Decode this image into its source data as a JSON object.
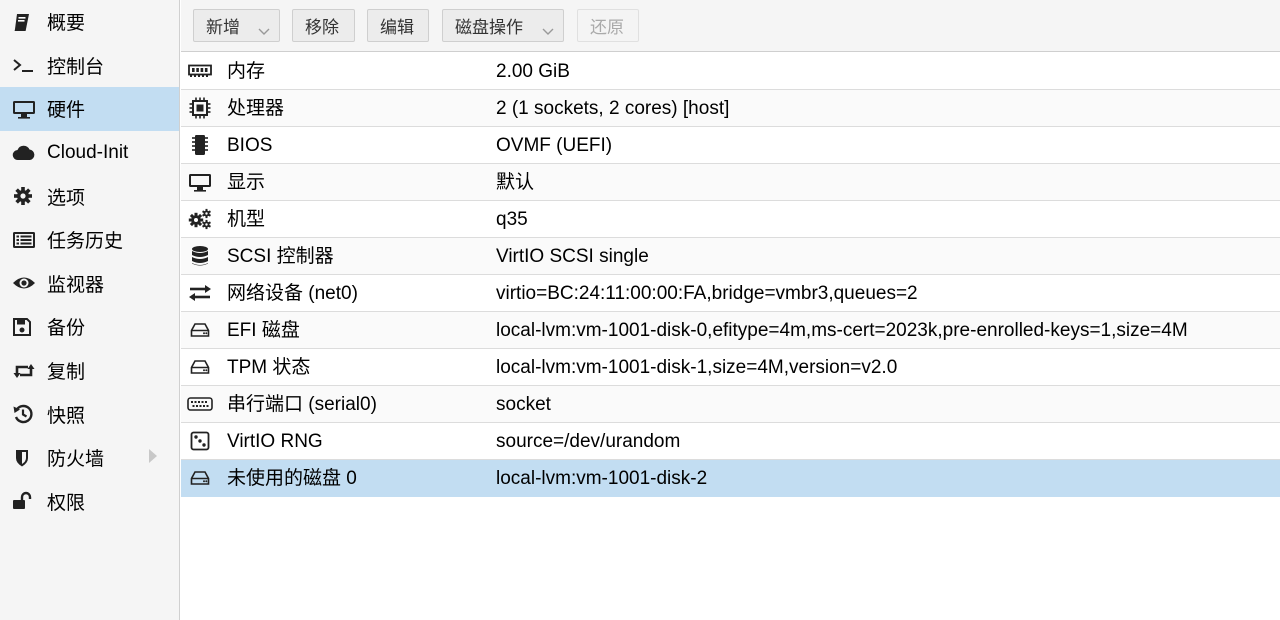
{
  "sidebar": {
    "items": [
      {
        "label": "概要",
        "icon": "book-icon"
      },
      {
        "label": "控制台",
        "icon": "terminal-icon"
      },
      {
        "label": "硬件",
        "icon": "desktop-icon"
      },
      {
        "label": "Cloud-Init",
        "icon": "cloud-icon"
      },
      {
        "label": "选项",
        "icon": "gear-icon"
      },
      {
        "label": "任务历史",
        "icon": "list-icon"
      },
      {
        "label": "监视器",
        "icon": "eye-icon"
      },
      {
        "label": "备份",
        "icon": "save-icon"
      },
      {
        "label": "复制",
        "icon": "retweet-icon"
      },
      {
        "label": "快照",
        "icon": "history-icon"
      },
      {
        "label": "防火墙",
        "icon": "shield-icon"
      },
      {
        "label": "权限",
        "icon": "unlock-icon"
      }
    ],
    "selected": "硬件"
  },
  "toolbar": {
    "add_label": "新增",
    "remove_label": "移除",
    "edit_label": "编辑",
    "disk_action_label": "磁盘操作",
    "revert_label": "还原"
  },
  "hardware": {
    "rows": [
      {
        "name": "内存",
        "value": "2.00 GiB",
        "icon": "memory-icon"
      },
      {
        "name": "处理器",
        "value": "2 (1 sockets, 2 cores) [host]",
        "icon": "cpu-icon"
      },
      {
        "name": "BIOS",
        "value": "OVMF (UEFI)",
        "icon": "microchip-icon"
      },
      {
        "name": "显示",
        "value": "默认",
        "icon": "desktop-icon"
      },
      {
        "name": "机型",
        "value": "q35",
        "icon": "cogs-icon"
      },
      {
        "name": "SCSI 控制器",
        "value": "VirtIO SCSI single",
        "icon": "database-icon"
      },
      {
        "name": "网络设备 (net0)",
        "value": "virtio=BC:24:11:00:00:FA,bridge=vmbr3,queues=2",
        "icon": "exchange-icon"
      },
      {
        "name": "EFI 磁盘",
        "value": "local-lvm:vm-1001-disk-0,efitype=4m,ms-cert=2023k,pre-enrolled-keys=1,size=4M",
        "icon": "hdd-icon"
      },
      {
        "name": "TPM 状态",
        "value": "local-lvm:vm-1001-disk-1,size=4M,version=v2.0",
        "icon": "hdd-icon"
      },
      {
        "name": "串行端口 (serial0)",
        "value": "socket",
        "icon": "keyboard-icon"
      },
      {
        "name": "VirtIO RNG",
        "value": "source=/dev/urandom",
        "icon": "dice-icon"
      },
      {
        "name": "未使用的磁盘 0",
        "value": "local-lvm:vm-1001-disk-2",
        "icon": "hdd-icon"
      }
    ],
    "selected_row": "未使用的磁盘 0"
  }
}
